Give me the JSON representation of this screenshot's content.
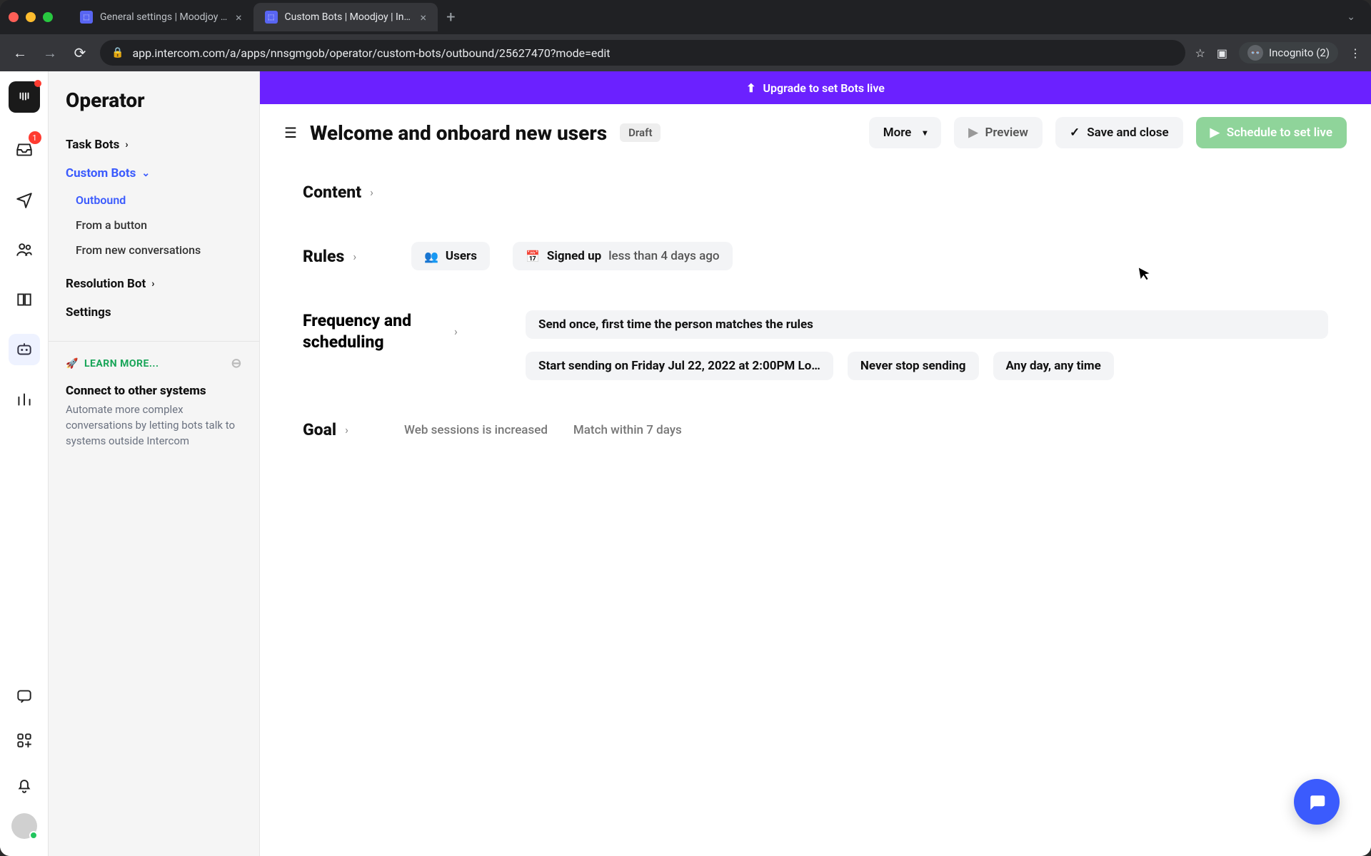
{
  "browser": {
    "tabs": [
      {
        "title": "General settings | Moodjoy | Int",
        "active": false
      },
      {
        "title": "Custom Bots | Moodjoy | Interc",
        "active": true
      }
    ],
    "url": "app.intercom.com/a/apps/nnsgmgob/operator/custom-bots/outbound/25627470?mode=edit",
    "incognito_label": "Incognito (2)"
  },
  "rail": {
    "inbox_badge": "1"
  },
  "sidebar": {
    "title": "Operator",
    "task_bots": "Task Bots",
    "custom_bots": "Custom Bots",
    "sub": {
      "outbound": "Outbound",
      "from_button": "From a button",
      "from_new": "From new conversations"
    },
    "resolution_bot": "Resolution Bot",
    "settings": "Settings",
    "learn_more": "LEARN MORE...",
    "connect_title": "Connect to other systems",
    "connect_desc": "Automate more complex conversations by letting bots talk to systems outside Intercom"
  },
  "banner": {
    "text": "Upgrade to set Bots live"
  },
  "header": {
    "title": "Welcome and onboard new users",
    "status": "Draft",
    "more": "More",
    "preview": "Preview",
    "save": "Save and close",
    "schedule": "Schedule to set live"
  },
  "sections": {
    "content": "Content",
    "rules": "Rules",
    "frequency": "Frequency and scheduling",
    "goal": "Goal"
  },
  "rules": {
    "users": "Users",
    "signed_up_label": "Signed up",
    "signed_up_value": "less than 4 days ago"
  },
  "frequency": {
    "send_once": "Send once, first time the person matches the rules",
    "start_sending": "Start sending on Friday Jul 22, 2022 at 2:00PM Lo…",
    "never_stop": "Never stop sending",
    "any_day": "Any day, any time"
  },
  "goal": {
    "metric": "Web sessions is increased",
    "match": "Match within 7 days"
  }
}
